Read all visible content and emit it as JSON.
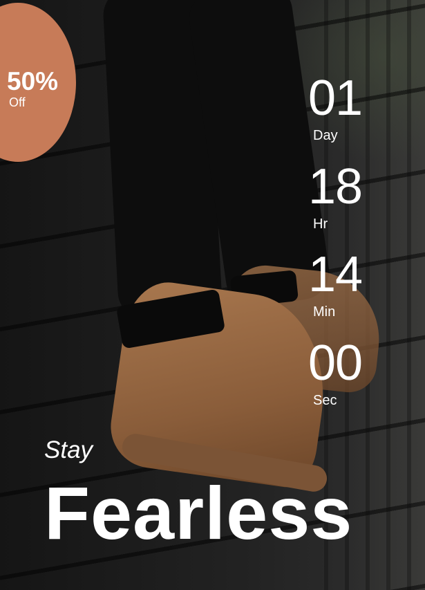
{
  "promo": {
    "percent": "50%",
    "off_label": "Off"
  },
  "countdown": [
    {
      "value": "01",
      "label": "Day"
    },
    {
      "value": "18",
      "label": "Hr"
    },
    {
      "value": "14",
      "label": "Min"
    },
    {
      "value": "00",
      "label": "Sec"
    }
  ],
  "headline": {
    "small": "Stay",
    "large": "Fearless"
  },
  "colors": {
    "badge": "#c77b58",
    "text": "#ffffff"
  }
}
